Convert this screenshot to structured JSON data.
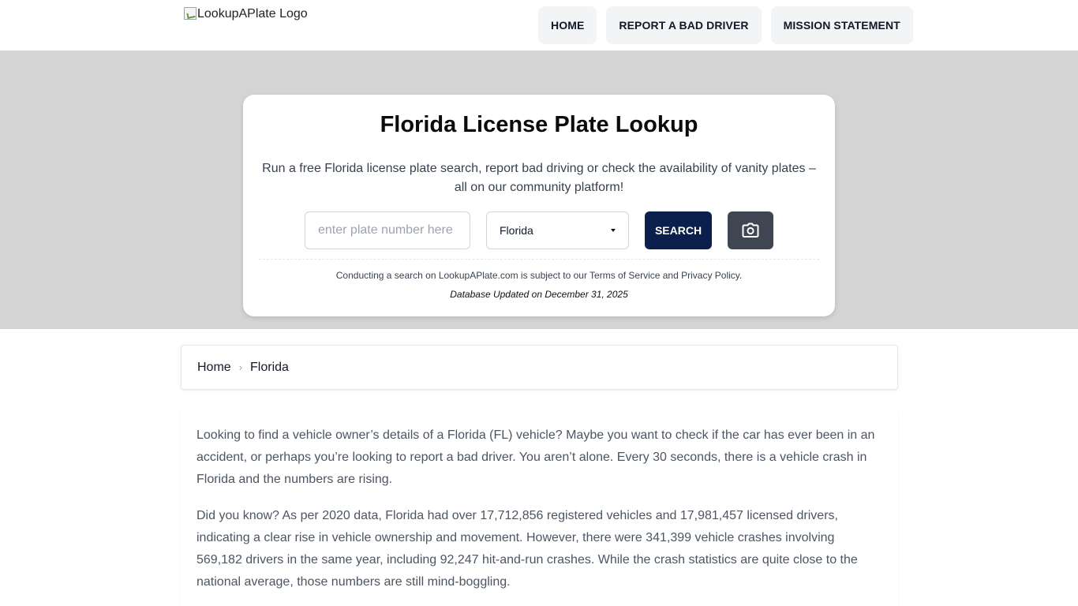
{
  "header": {
    "logo_alt": "LookupAPlate Logo",
    "nav": [
      {
        "label": "HOME"
      },
      {
        "label": "REPORT A BAD DRIVER"
      },
      {
        "label": "MISSION STATEMENT"
      }
    ]
  },
  "hero": {
    "title": "Florida License Plate Lookup",
    "lead": "Run a free Florida license plate search, report bad driving or check the availability of vanity plates – all on our community platform!",
    "search": {
      "placeholder": "enter plate number here",
      "value": "",
      "state_selected": "Florida",
      "button_label": "SEARCH",
      "camera_icon": "camera-icon"
    },
    "terms": "Conducting a search on LookupAPlate.com is subject to our Terms of Service and Privacy Policy.",
    "updated": "Database Updated on December 31, 2025"
  },
  "breadcrumb": {
    "items": [
      {
        "label": "Home"
      },
      {
        "label": "Florida"
      }
    ],
    "separator_icon": "chevron-right-icon"
  },
  "content": {
    "paragraphs": [
      "Looking to find a vehicle owner’s details of a Florida (FL) vehicle? Maybe you want to check if the car has ever been in an accident, or perhaps you’re looking to report a bad driver. You aren’t alone. Every 30 seconds, there is a vehicle crash in Florida and the numbers are rising.",
      "Did you know? As per 2020 data, Florida had over 17,712,856 registered vehicles and 17,981,457 licensed drivers, indicating a clear rise in vehicle ownership and movement. However, there were 341,399 vehicle crashes involving 569,182 drivers in the same year, including 92,247 hit-and-run crashes. While the crash statistics are quite close to the national average, those numbers are still mind-boggling."
    ]
  },
  "colors": {
    "primary_button": "#0b1f4d",
    "camera_button": "#3f4551",
    "hero_background": "#d4d4d4"
  }
}
